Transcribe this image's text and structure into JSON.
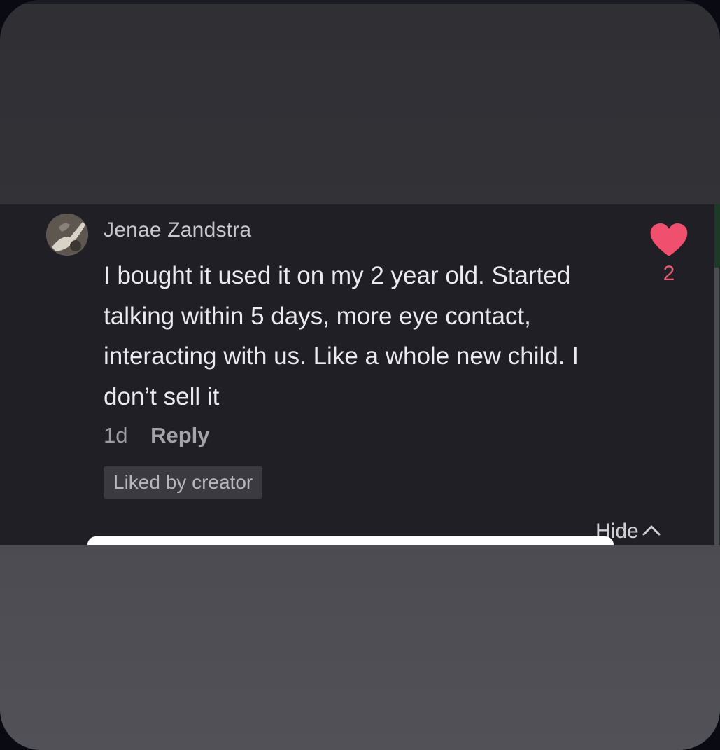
{
  "comment": {
    "username": "Jenae Zandstra",
    "text": "I bought it used it on my 2 year old. Started talking within 5 days, more eye contact, interacting with us. Like a whole new child. I don’t sell it",
    "time": "1d",
    "reply_label": "Reply",
    "badge": "Liked by creator",
    "like_count": "2",
    "hide_label": "Hide"
  },
  "colors": {
    "heart": "#f0506e",
    "like_count": "#e95a73",
    "panel_background": "#1f1f25"
  },
  "icons": {
    "avatar": "avatar",
    "like": "heart-icon",
    "collapse": "chevron-up-icon"
  }
}
